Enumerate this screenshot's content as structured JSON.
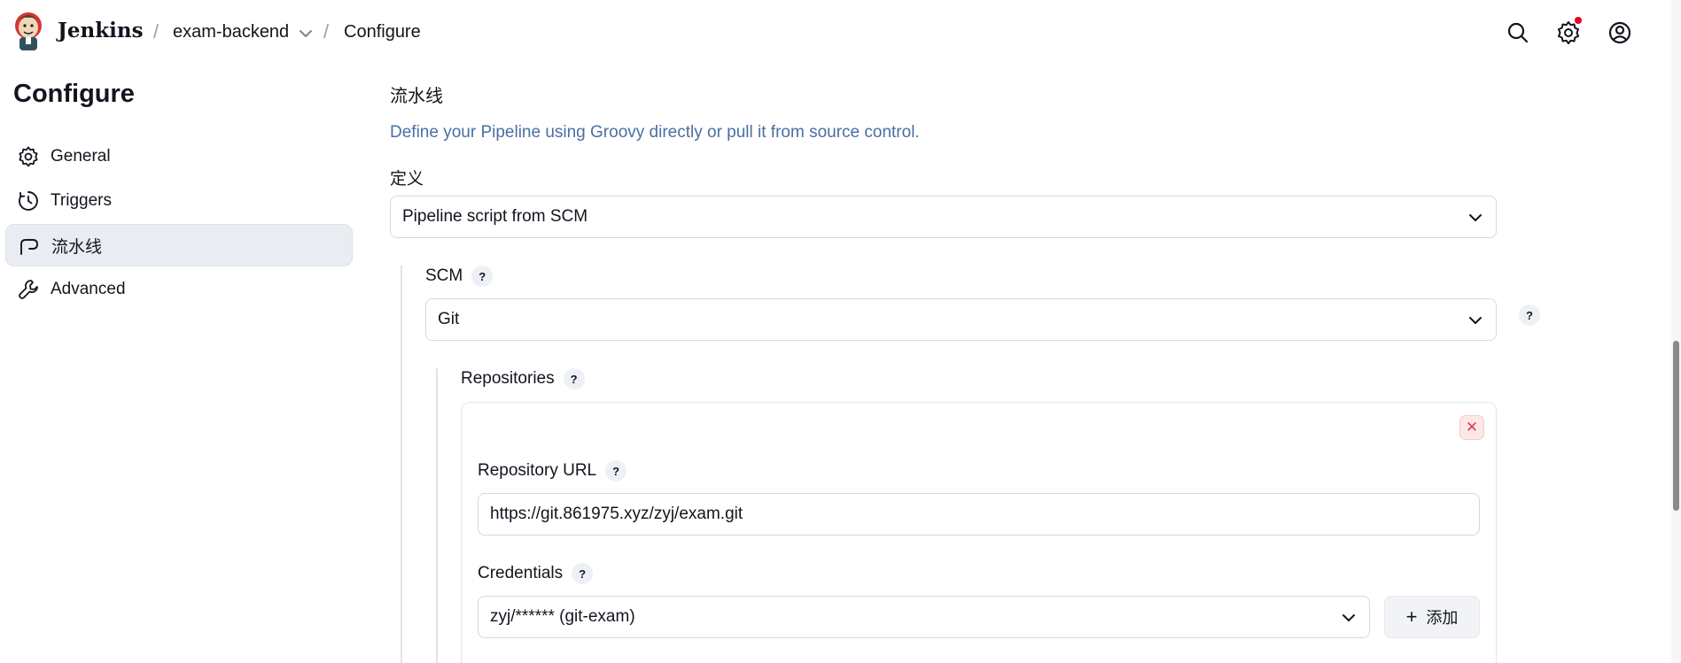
{
  "header": {
    "brand": "Jenkins",
    "breadcrumb": [
      {
        "label": "exam-backend"
      },
      {
        "label": "Configure"
      }
    ],
    "separator": "/"
  },
  "sidebar": {
    "title": "Configure",
    "items": [
      {
        "label": "General",
        "icon": "gear-icon",
        "active": false
      },
      {
        "label": "Triggers",
        "icon": "clock-icon",
        "active": false
      },
      {
        "label": "流水线",
        "icon": "pipeline-icon",
        "active": true
      },
      {
        "label": "Advanced",
        "icon": "wrench-icon",
        "active": false
      }
    ]
  },
  "main": {
    "section_title": "流水线",
    "description": "Define your Pipeline using Groovy directly or pull it from source control.",
    "definition": {
      "label": "定义",
      "value": "Pipeline script from SCM"
    },
    "scm": {
      "label": "SCM",
      "value": "Git"
    },
    "repositories": {
      "label": "Repositories",
      "delete_label": "✕",
      "url_label": "Repository URL",
      "url_value": "https://git.861975.xyz/zyj/exam.git",
      "credentials_label": "Credentials",
      "credentials_value": "zyj/****** (git-exam)",
      "add_label": "添加"
    },
    "help_glyph": "?"
  },
  "colors": {
    "accent_link": "#4a6fa3",
    "active_bg": "#e9edf2",
    "notification": "#e6001f",
    "danger": "#e23b3b"
  }
}
